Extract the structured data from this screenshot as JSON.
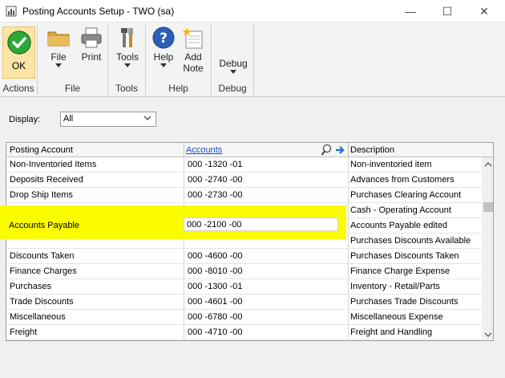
{
  "window": {
    "title": "Posting Accounts Setup  -  TWO (sa)",
    "minimize": "—",
    "maximize": "☐",
    "close": "✕"
  },
  "ribbon": {
    "groups": {
      "actions": "Actions",
      "file": "File",
      "tools": "Tools",
      "help": "Help",
      "debug": "Debug"
    },
    "buttons": {
      "ok": "OK",
      "file": "File",
      "print": "Print",
      "tools": "Tools",
      "help": "Help",
      "add_note_1": "Add",
      "add_note_2": "Note",
      "debug": "Debug"
    }
  },
  "display": {
    "label": "Display:",
    "value": "All"
  },
  "grid": {
    "headers": {
      "posting_account": "Posting Account",
      "accounts": "Accounts",
      "description": "Description"
    },
    "rows": [
      {
        "posting_account": "Non-Inventoried Items",
        "account": "000 -1320 -01",
        "description": "Non-inventoried item"
      },
      {
        "posting_account": "Deposits Received",
        "account": "000 -2740 -00",
        "description": "Advances from Customers"
      },
      {
        "posting_account": "Drop Ship Items",
        "account": "000 -2730 -00",
        "description": "Purchases Clearing Account"
      },
      {
        "posting_account": "",
        "account": "",
        "description": "Cash - Operating Account"
      },
      {
        "posting_account": "",
        "account": "",
        "description": "Accounts Payable edited"
      },
      {
        "posting_account": "",
        "account": "",
        "description": "Purchases Discounts Available"
      },
      {
        "posting_account": "Discounts Taken",
        "account": "000 -4600 -00",
        "description": "Purchases Discounts Taken"
      },
      {
        "posting_account": "Finance Charges",
        "account": "000 -8010 -00",
        "description": "Finance Charge Expense"
      },
      {
        "posting_account": "Purchases",
        "account": "000 -1300 -01",
        "description": "Inventory - Retail/Parts"
      },
      {
        "posting_account": "Trade Discounts",
        "account": "000 -4601 -00",
        "description": "Purchases Trade Discounts"
      },
      {
        "posting_account": "Miscellaneous",
        "account": "000 -6780 -00",
        "description": "Miscellaneous Expense"
      },
      {
        "posting_account": "Freight",
        "account": "000 -4710 -00",
        "description": "Freight and Handling"
      }
    ],
    "highlighted": {
      "posting_account": "Accounts Payable",
      "account": "000 -2100 -00"
    }
  },
  "colors": {
    "highlight": "#fcfc00",
    "link": "#1a4fc2",
    "ok_green": "#2fa83a"
  }
}
